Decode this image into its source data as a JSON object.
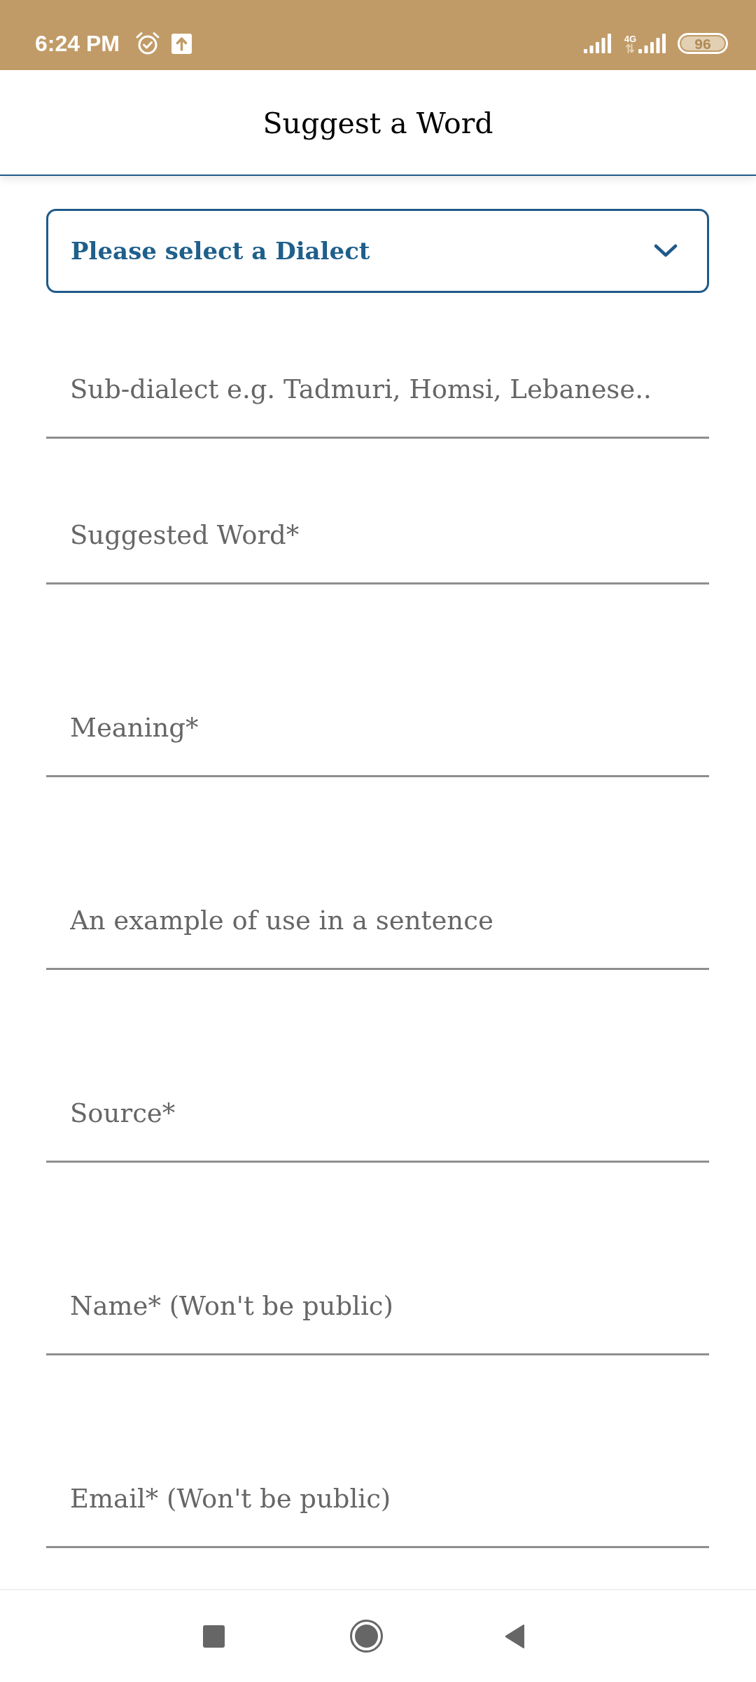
{
  "status_bar": {
    "time": "6:24 PM",
    "network": "4G",
    "battery": "96"
  },
  "header": {
    "title": "Suggest a Word"
  },
  "dialect_select": {
    "prompt": "Please select a Dialect"
  },
  "fields": [
    {
      "placeholder": "Sub-dialect e.g. Tadmuri, Homsi, Lebanese.."
    },
    {
      "placeholder": "Suggested Word*"
    },
    {
      "placeholder": "Meaning*"
    },
    {
      "placeholder": "An example of use in a sentence"
    },
    {
      "placeholder": "Source*"
    },
    {
      "placeholder": "Name* (Won't be public)"
    },
    {
      "placeholder": "Email* (Won't be public)"
    }
  ]
}
